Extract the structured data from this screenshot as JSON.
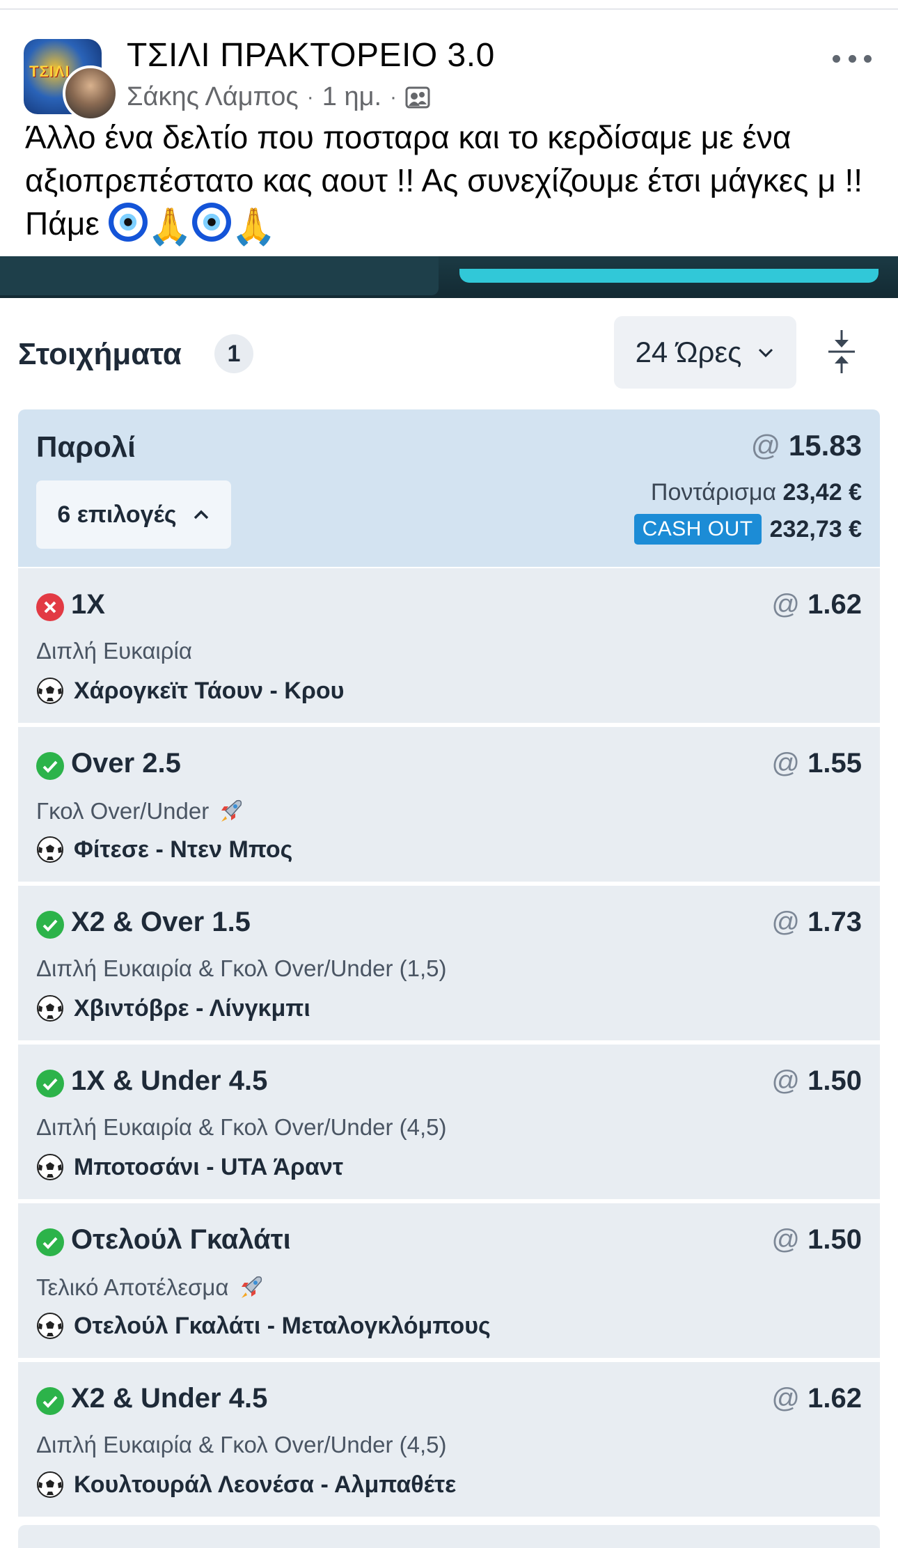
{
  "post": {
    "title": "ΤΣΙΛΙ ΠΡΑΚΤΟΡΕΙΟ 3.0",
    "author": "Σάκης Λάμπος",
    "time": "1 ημ.",
    "separator": "·",
    "text_main": "Άλλο ένα δελτίο που ποσταρα και το κερδίσαμε με ένα αξιοπρεπέστατο κας αουτ !! Ας συνεχίζουμε έτσι μάγκες μ !! Πάμε ",
    "group_logo_text": "ΤΣΙΛΙ",
    "icons": {
      "more": "more-dots-icon",
      "audience": "group-members-icon",
      "emoji_1": "nazar-eye-icon",
      "emoji_2": "praying-hands-icon"
    }
  },
  "bets": {
    "title": "Στοιχήματα",
    "count": "1",
    "period": "24 Ώρες",
    "collapse_icon": "collapse-arrows-icon"
  },
  "parlay": {
    "label": "Παρολί",
    "odds_prefix": "@",
    "odds": "15.83",
    "selections_label": "6 επιλογές",
    "stake_label": "Ποντάρισμα",
    "stake_value": "23,42 €",
    "cashout_label": "CASH OUT",
    "cashout_value": "232,73 €"
  },
  "selections": [
    {
      "status": "lost",
      "pick": "1X",
      "odds": "1.62",
      "market": "Διπλή Ευκαιρία",
      "rocket": false,
      "match": "Χάρογκεϊτ Τάουν - Κρου"
    },
    {
      "status": "won",
      "pick": "Over 2.5",
      "odds": "1.55",
      "market": "Γκολ Over/Under",
      "rocket": true,
      "match": "Φίτεσε - Ντεν Μπος"
    },
    {
      "status": "won",
      "pick": "X2 & Over 1.5",
      "odds": "1.73",
      "market": "Διπλή Ευκαιρία & Γκολ Over/Under (1,5)",
      "rocket": false,
      "match": "Χβιντόβρε - Λίνγκμπι"
    },
    {
      "status": "won",
      "pick": "1X & Under 4.5",
      "odds": "1.50",
      "market": "Διπλή Ευκαιρία & Γκολ Over/Under (4,5)",
      "rocket": false,
      "match": "Μποτοσάνι - UTA Άραντ"
    },
    {
      "status": "won",
      "pick": "Οτελούλ Γκαλάτι",
      "odds": "1.50",
      "market": "Τελικό Αποτέλεσμα",
      "rocket": true,
      "match": "Οτελούλ Γκαλάτι - Μεταλογκλόμπους"
    },
    {
      "status": "won",
      "pick": "X2 & Under 4.5",
      "odds": "1.62",
      "market": "Διπλή Ευκαιρία & Γκολ Over/Under (4,5)",
      "rocket": false,
      "match": "Κουλτουράλ Λεονέσα - Αλμπαθέτε"
    }
  ],
  "colors": {
    "win": "#2cb34a",
    "lose": "#e23a44",
    "cashout": "#1c8cd6",
    "parlay_bg": "#d3e3f1",
    "card_bg": "#e8edf2"
  }
}
